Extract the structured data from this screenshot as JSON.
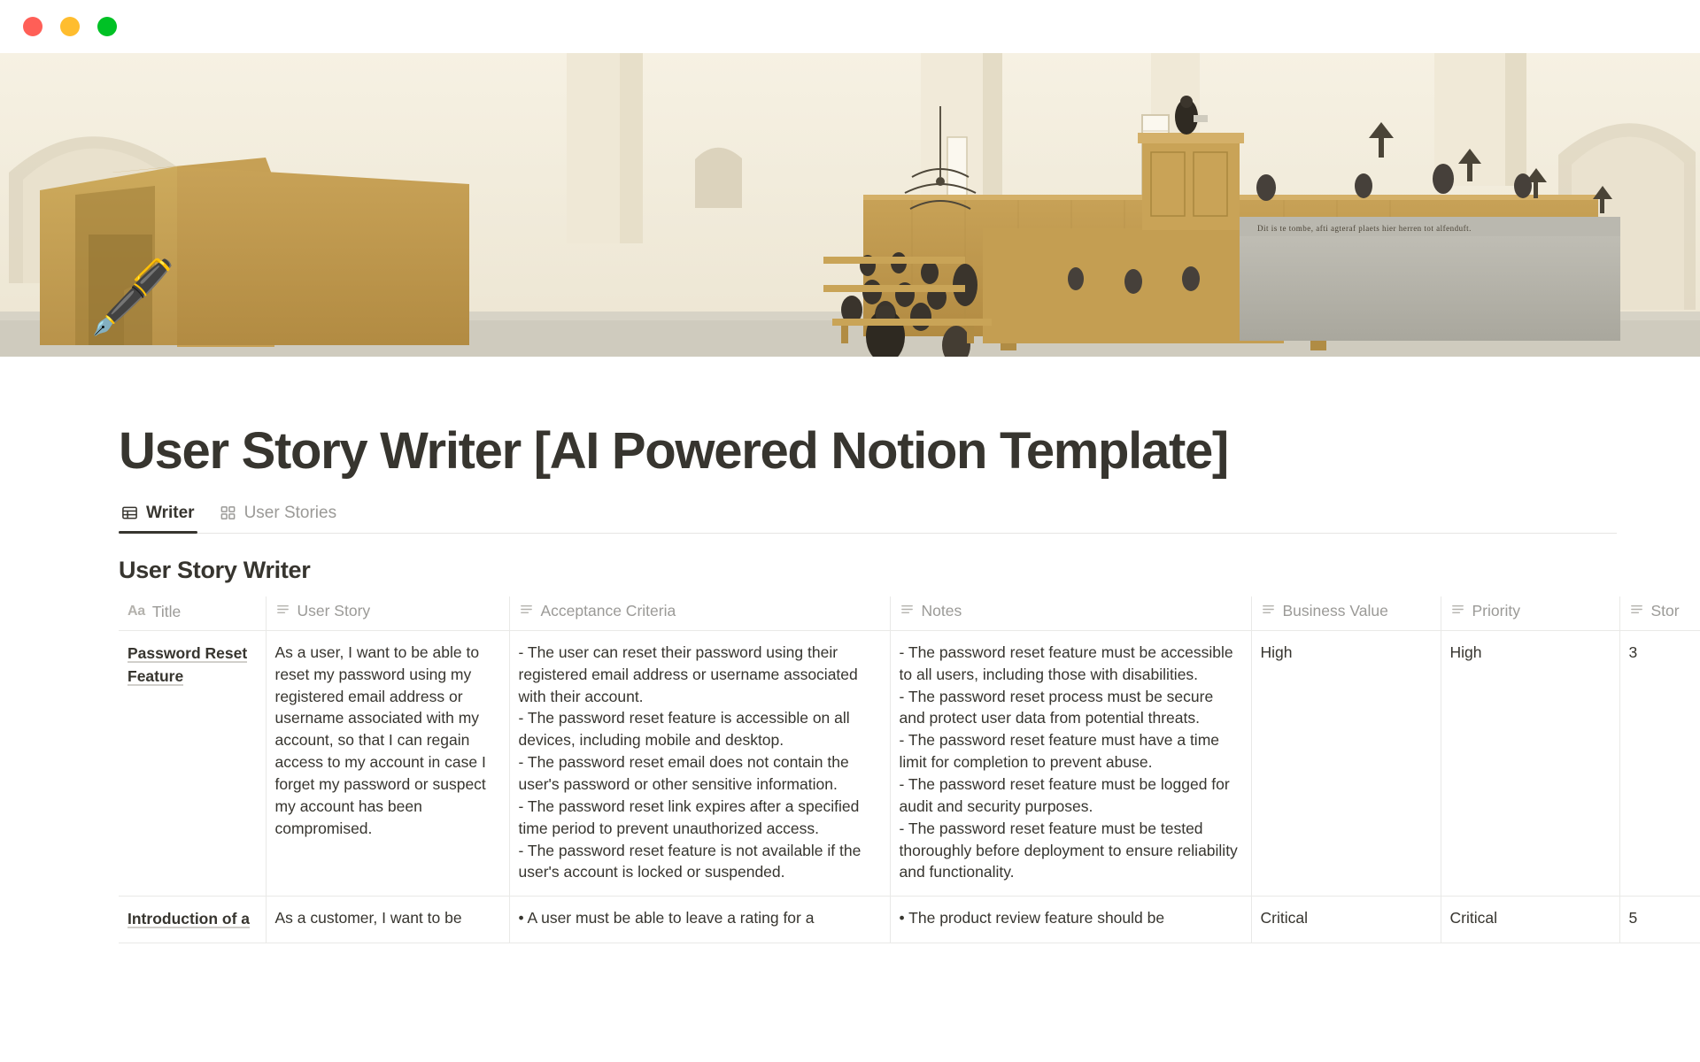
{
  "window": {
    "controls": [
      {
        "name": "close",
        "color": "#ff5f57"
      },
      {
        "name": "minimize",
        "color": "#ffbd2e"
      },
      {
        "name": "maximize",
        "color": "#00c125"
      }
    ]
  },
  "cover": {
    "alt": "Dutch Golden Age church interior painting",
    "palette": {
      "wall": "#f2ecdc",
      "wood": "#c9a455",
      "wood_dark": "#b08f3f",
      "stone": "#b7b6ae",
      "floor": "#cfcbbe",
      "figure": "#3b352c"
    }
  },
  "page": {
    "icon": "🖋️",
    "icon_name": "fountain-pen-emoji",
    "title": "User Story Writer [AI Powered Notion Template]"
  },
  "tabs": [
    {
      "label": "Writer",
      "icon": "table-icon",
      "active": true
    },
    {
      "label": "User Stories",
      "icon": "gallery-icon",
      "active": false
    }
  ],
  "database": {
    "title": "User Story Writer",
    "columns": [
      {
        "label": "Title",
        "icon": "title-aa-icon"
      },
      {
        "label": "User Story",
        "icon": "text-lines-icon"
      },
      {
        "label": "Acceptance Criteria",
        "icon": "text-lines-icon"
      },
      {
        "label": "Notes",
        "icon": "text-lines-icon"
      },
      {
        "label": "Business Value",
        "icon": "text-lines-icon"
      },
      {
        "label": "Priority",
        "icon": "text-lines-icon"
      },
      {
        "label": "Stor",
        "icon": "text-lines-icon"
      }
    ],
    "rows": [
      {
        "title": "Password Reset Feature",
        "user_story": "As a user, I want to be able to reset my password using my registered email address or username associated with my account, so that I can regain access to my account in case I forget my password or suspect my account has been compromised.",
        "acceptance_criteria": "- The user can reset their password using their registered email address or username associated with their account.\n- The password reset feature is accessible on all devices, including mobile and desktop.\n- The password reset email does not contain the user's password or other sensitive information.\n- The password reset link expires after a specified time period to prevent unauthorized access.\n- The password reset feature is not available if the user's account is locked or suspended.",
        "notes": "- The password reset feature must be accessible to all users, including those with disabilities.\n- The password reset process must be secure and protect user data from potential threats.\n- The password reset feature must have a time limit for completion to prevent abuse.\n- The password reset feature must be logged for audit and security purposes.\n- The password reset feature must be tested thoroughly before deployment to ensure reliability and functionality.",
        "business_value": "High",
        "priority": "High",
        "story_points": "3"
      },
      {
        "title": "Introduction of a",
        "user_story": "As a customer, I want to be",
        "acceptance_criteria": "• A user must be able to leave a rating for a",
        "notes": "• The product review feature should be",
        "business_value": "Critical",
        "priority": "Critical",
        "story_points": "5"
      }
    ]
  }
}
